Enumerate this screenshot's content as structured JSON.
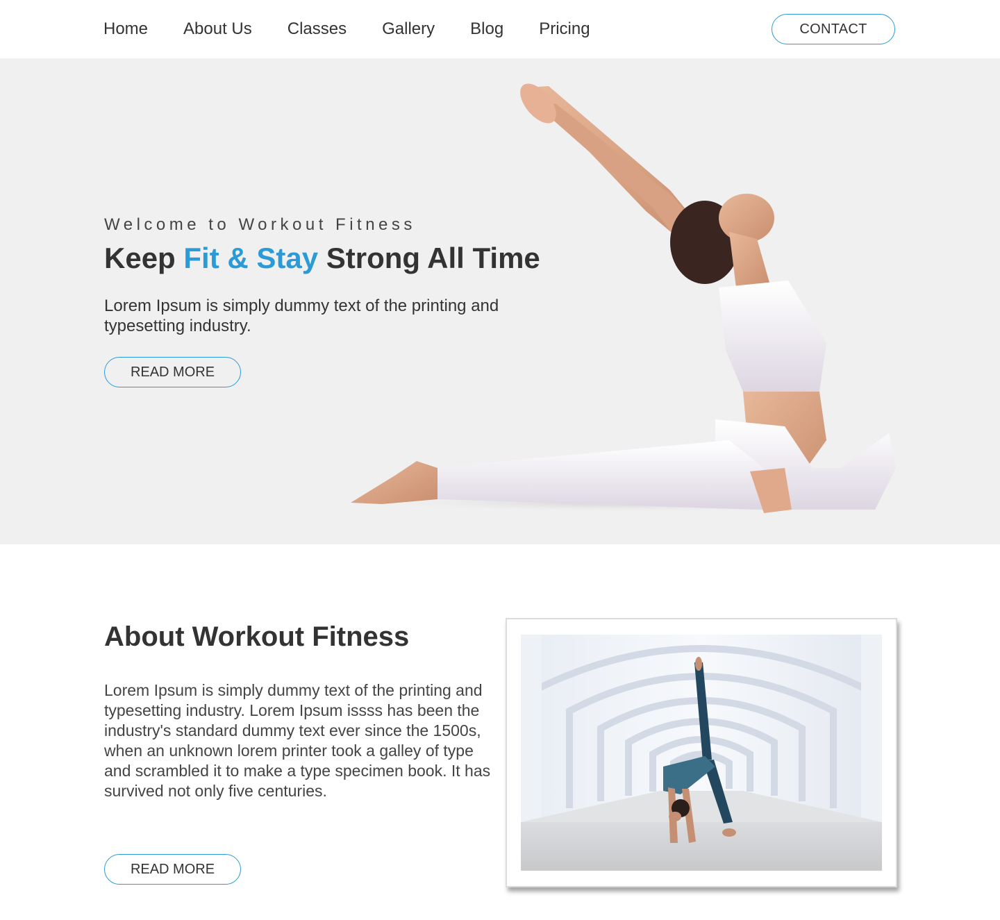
{
  "nav": {
    "links": [
      "Home",
      "About Us",
      "Classes",
      "Gallery",
      "Blog",
      "Pricing"
    ],
    "contact_label": "CONTACT"
  },
  "hero": {
    "subtitle": "Welcome to Workout Fitness",
    "title_part1": "Keep ",
    "title_accent": "Fit & Stay",
    "title_part2": " Strong All Time",
    "description": "Lorem Ipsum is simply dummy text of the printing and typesetting industry.",
    "button_label": "READ MORE"
  },
  "about": {
    "title": "About Workout Fitness",
    "paragraph1": "Lorem Ipsum is simply dummy text of the printing and typesetting industry. Lorem Ipsum issss has been the industry's standard dummy text ever since the 1500s,",
    "paragraph2": "when an unknown lorem printer took a galley of type and scrambled it to make a type specimen book. It has survived not only five centuries.",
    "button_label": "READ MORE"
  },
  "colors": {
    "accent": "#2a9bd6",
    "text": "#333333",
    "hero_background": "#f0f0f0"
  }
}
